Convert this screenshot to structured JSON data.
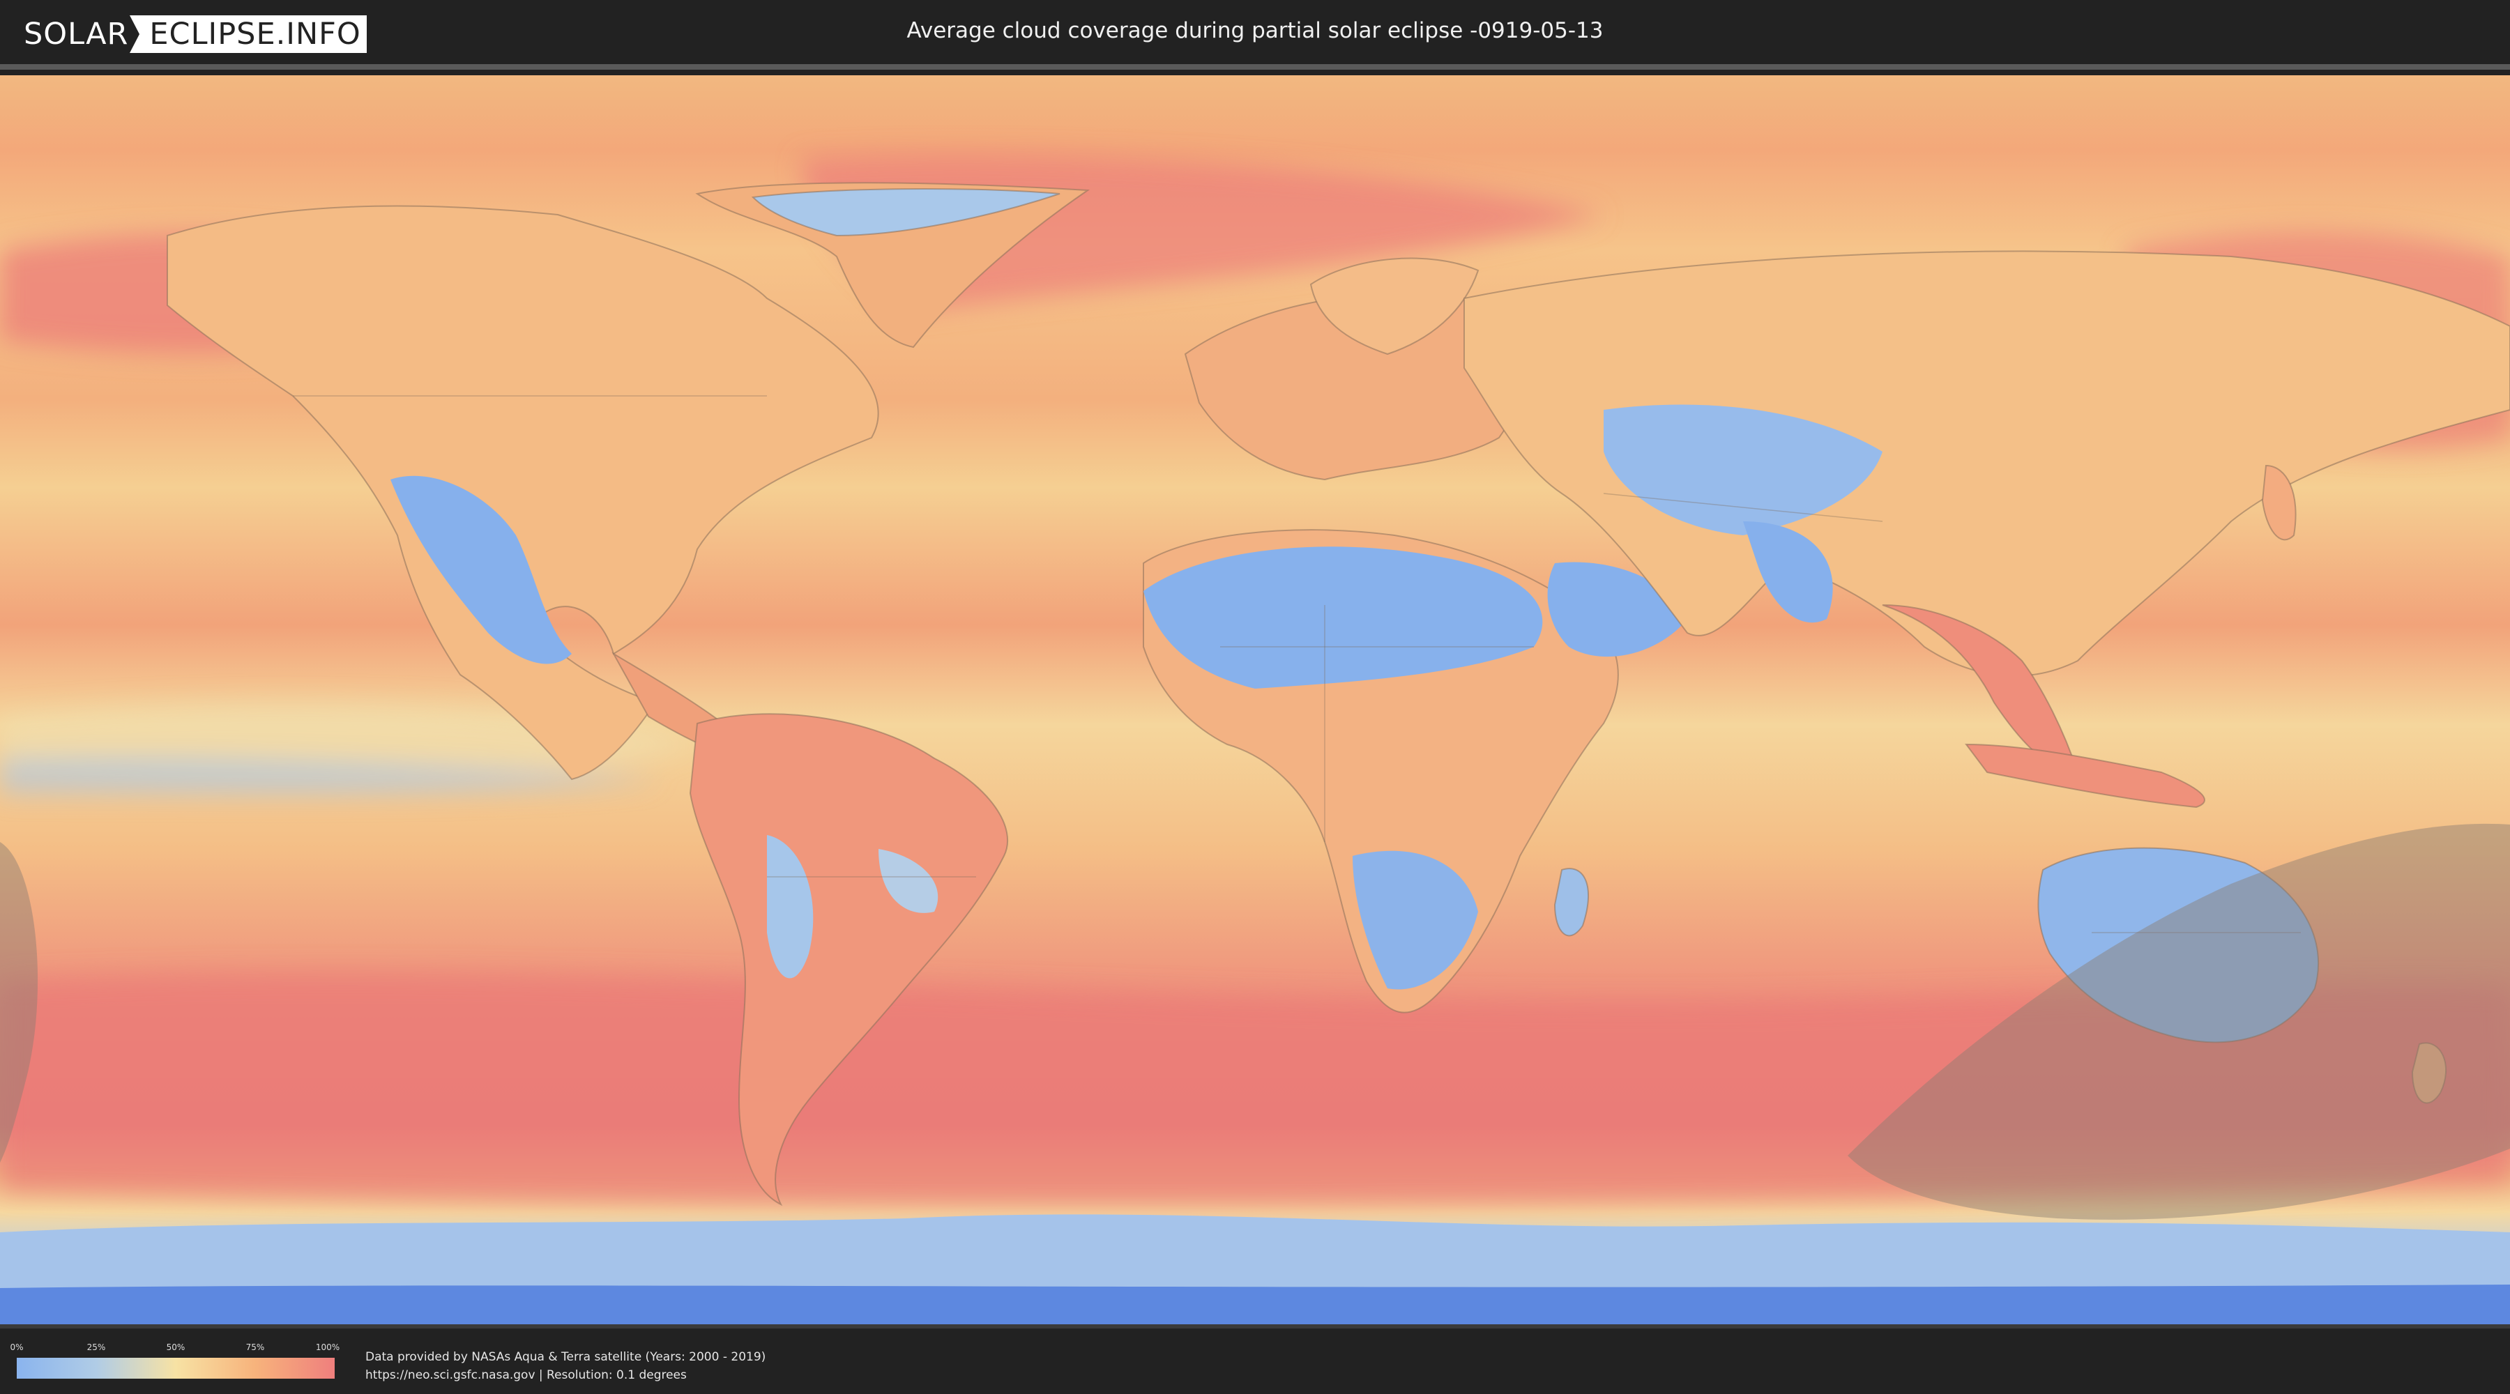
{
  "header": {
    "logo_left": "SOLAR",
    "logo_right": "ECLIPSE.INFO",
    "title": "Average cloud coverage during partial solar eclipse -0919-05-13"
  },
  "legend": {
    "ticks": [
      "0%",
      "25%",
      "50%",
      "75%",
      "100%"
    ],
    "tick_values": [
      0,
      25,
      50,
      75,
      100
    ],
    "colors": [
      "#8ab4ee",
      "#b0cce6",
      "#f7e2a4",
      "#f7b37c",
      "#ef7f7d"
    ]
  },
  "footer": {
    "source_line": "Data provided by NASAs Aqua & Terra satellite (Years: 2000 - 2019)",
    "url_line": "https://neo.sci.gsfc.nasa.gov | Resolution: 0.1 degrees"
  },
  "map": {
    "projection": "equirectangular",
    "layer": "average cloud coverage",
    "eclipse_shading": "partial eclipse visibility zone",
    "colors": {
      "clear": "#7fa9ec",
      "low": "#a9c8e8",
      "mid": "#f5dca0",
      "high": "#f3a477",
      "overcast": "#ec7d78",
      "shading": "#8a7c70",
      "border": "#7a6a5a"
    }
  }
}
